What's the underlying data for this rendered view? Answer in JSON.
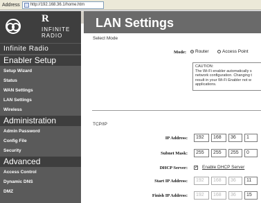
{
  "browser": {
    "address_label": "Address",
    "url": "http://192.168.36.1/home.htm"
  },
  "logo": {
    "mark": "R",
    "line1": "INFINITE",
    "line2": "RADIO"
  },
  "sidebar": {
    "brand": "Infinite Radio",
    "sections": [
      {
        "heading": "Enabler Setup",
        "items": [
          "Setup Wizard",
          "Status",
          "WAN Settings",
          "LAN Settings",
          "Wireless"
        ]
      },
      {
        "heading": "Administration",
        "items": [
          "Admin Password",
          "Config File",
          "Security"
        ]
      },
      {
        "heading": "Advanced",
        "items": [
          "Access Control",
          "Dynamic DNS",
          "DMZ"
        ]
      }
    ]
  },
  "page": {
    "title": "LAN Settings",
    "select_mode_label": "Select Mode",
    "mode": {
      "label": "Mode:",
      "options": [
        "Router",
        "Access Point"
      ],
      "selected": "Router"
    },
    "caution": {
      "heading": "CAUTION:",
      "lines": [
        "The Wi-Fi enabler automatically s",
        "network configuration. Changing t",
        "result in your Wi-Fi Enabler not w",
        "applications."
      ]
    },
    "tcpip_label": "TCP/IP",
    "ip_address": {
      "label": "IP Address:",
      "octets": [
        "192",
        "168",
        "36",
        "1"
      ]
    },
    "subnet_mask": {
      "label": "Subnet Mask:",
      "octets": [
        "255",
        "255",
        "255",
        "0"
      ]
    },
    "dhcp_server": {
      "label": "DHCP Server:",
      "checkbox_label": "Enable DHCP Server",
      "checked": true
    },
    "start_ip": {
      "label": "Start IP Address:",
      "octets": [
        "192",
        "168",
        "36",
        "11"
      ]
    },
    "finish_ip": {
      "label": "Finish IP Address:",
      "octets": [
        "192",
        "168",
        "36",
        "15"
      ]
    }
  },
  "colors": {
    "sidebar_bg": "#5a5a5a",
    "sidebar_header_bg": "#3e3e3e",
    "title_band": "#6a6a6a"
  }
}
